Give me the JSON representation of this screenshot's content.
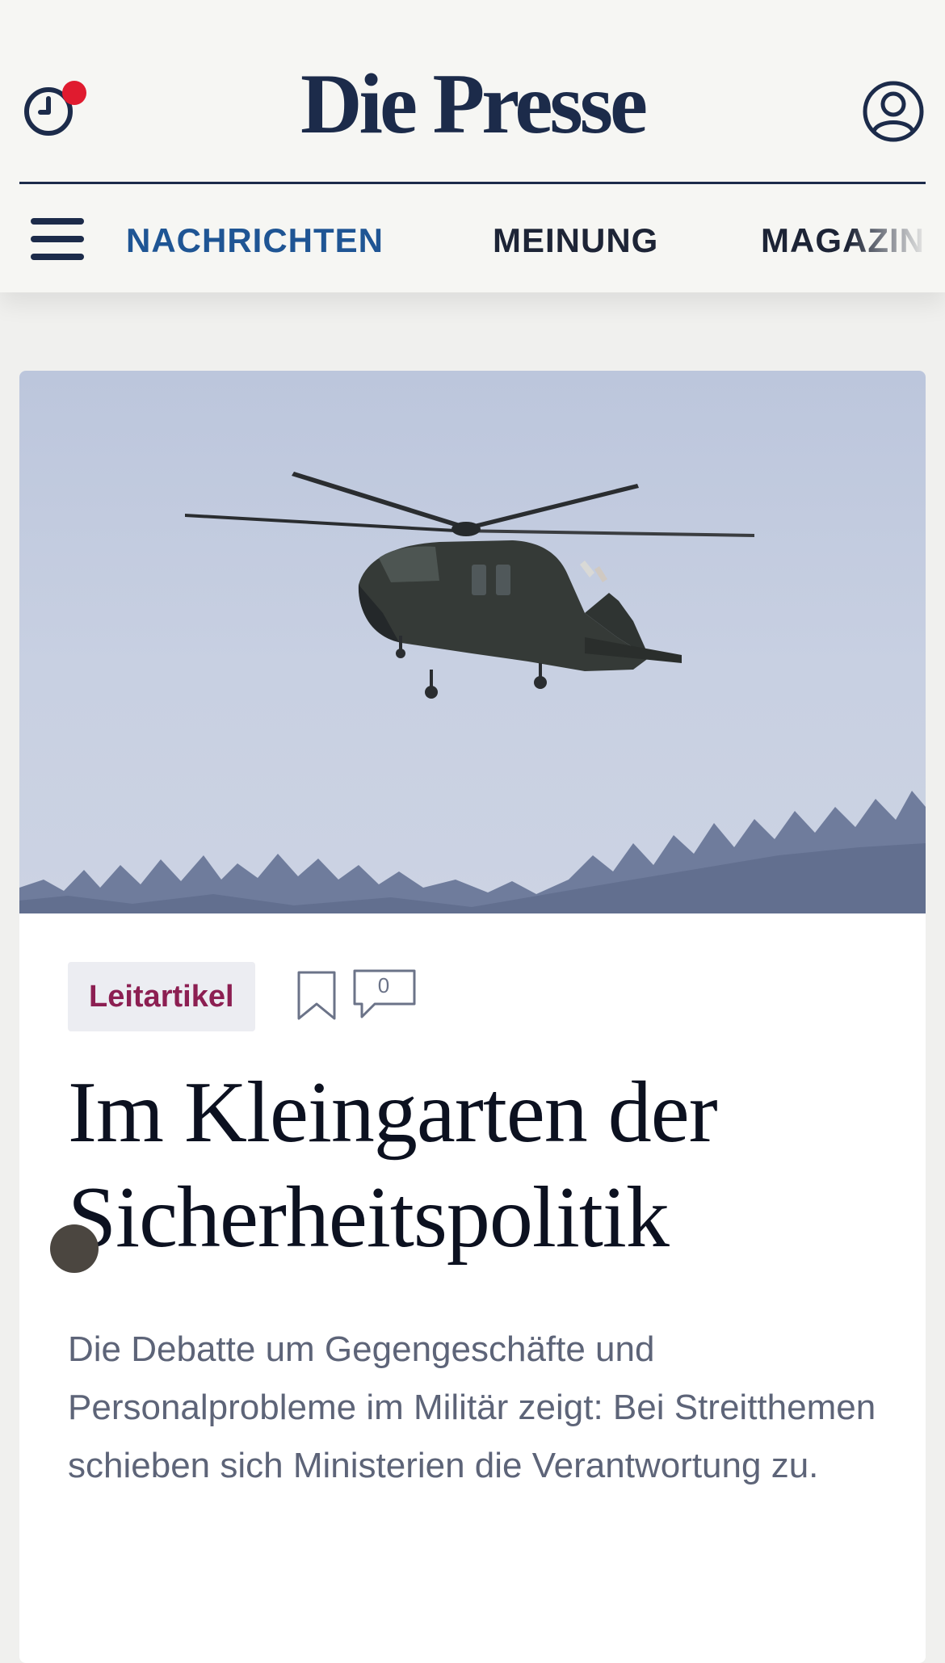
{
  "header": {
    "logo": "Die Presse",
    "recent_icon": "clock-icon",
    "account_icon": "user-circle-icon",
    "notification_color": "#e01b2f"
  },
  "nav": {
    "menu_icon": "hamburger-menu-icon",
    "items": [
      {
        "label": "NACHRICHTEN",
        "active": true
      },
      {
        "label": "MEINUNG",
        "active": false
      },
      {
        "label": "MAGAZIN",
        "active": false
      }
    ],
    "active_color": "#1f5594"
  },
  "article": {
    "category": "Leitartikel",
    "comment_count": "0",
    "bookmark_icon": "bookmark-icon",
    "comment_icon": "comment-bubble-icon",
    "headline_line1": "Im Kleingarten der",
    "headline_line2": "Sicherheitspolitik",
    "lead": "Die Debatte um Gegengeschäfte und Personalprobleme im Militär zeigt: Bei Streitthemen schieben sich Ministerien die Verantwortung zu.",
    "category_color": "#8c1f52"
  },
  "colors": {
    "brand_navy": "#1c2b4a",
    "background": "#f6f6f3"
  }
}
